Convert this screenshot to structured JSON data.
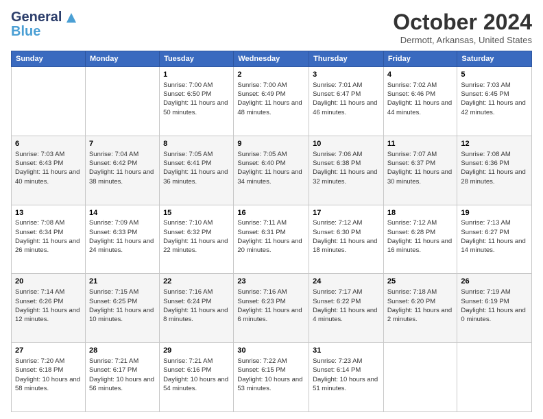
{
  "header": {
    "logo_line1": "General",
    "logo_line2": "Blue",
    "month_title": "October 2024",
    "location": "Dermott, Arkansas, United States"
  },
  "days_of_week": [
    "Sunday",
    "Monday",
    "Tuesday",
    "Wednesday",
    "Thursday",
    "Friday",
    "Saturday"
  ],
  "weeks": [
    [
      {
        "day": "",
        "info": ""
      },
      {
        "day": "",
        "info": ""
      },
      {
        "day": "1",
        "info": "Sunrise: 7:00 AM\nSunset: 6:50 PM\nDaylight: 11 hours and 50 minutes."
      },
      {
        "day": "2",
        "info": "Sunrise: 7:00 AM\nSunset: 6:49 PM\nDaylight: 11 hours and 48 minutes."
      },
      {
        "day": "3",
        "info": "Sunrise: 7:01 AM\nSunset: 6:47 PM\nDaylight: 11 hours and 46 minutes."
      },
      {
        "day": "4",
        "info": "Sunrise: 7:02 AM\nSunset: 6:46 PM\nDaylight: 11 hours and 44 minutes."
      },
      {
        "day": "5",
        "info": "Sunrise: 7:03 AM\nSunset: 6:45 PM\nDaylight: 11 hours and 42 minutes."
      }
    ],
    [
      {
        "day": "6",
        "info": "Sunrise: 7:03 AM\nSunset: 6:43 PM\nDaylight: 11 hours and 40 minutes."
      },
      {
        "day": "7",
        "info": "Sunrise: 7:04 AM\nSunset: 6:42 PM\nDaylight: 11 hours and 38 minutes."
      },
      {
        "day": "8",
        "info": "Sunrise: 7:05 AM\nSunset: 6:41 PM\nDaylight: 11 hours and 36 minutes."
      },
      {
        "day": "9",
        "info": "Sunrise: 7:05 AM\nSunset: 6:40 PM\nDaylight: 11 hours and 34 minutes."
      },
      {
        "day": "10",
        "info": "Sunrise: 7:06 AM\nSunset: 6:38 PM\nDaylight: 11 hours and 32 minutes."
      },
      {
        "day": "11",
        "info": "Sunrise: 7:07 AM\nSunset: 6:37 PM\nDaylight: 11 hours and 30 minutes."
      },
      {
        "day": "12",
        "info": "Sunrise: 7:08 AM\nSunset: 6:36 PM\nDaylight: 11 hours and 28 minutes."
      }
    ],
    [
      {
        "day": "13",
        "info": "Sunrise: 7:08 AM\nSunset: 6:34 PM\nDaylight: 11 hours and 26 minutes."
      },
      {
        "day": "14",
        "info": "Sunrise: 7:09 AM\nSunset: 6:33 PM\nDaylight: 11 hours and 24 minutes."
      },
      {
        "day": "15",
        "info": "Sunrise: 7:10 AM\nSunset: 6:32 PM\nDaylight: 11 hours and 22 minutes."
      },
      {
        "day": "16",
        "info": "Sunrise: 7:11 AM\nSunset: 6:31 PM\nDaylight: 11 hours and 20 minutes."
      },
      {
        "day": "17",
        "info": "Sunrise: 7:12 AM\nSunset: 6:30 PM\nDaylight: 11 hours and 18 minutes."
      },
      {
        "day": "18",
        "info": "Sunrise: 7:12 AM\nSunset: 6:28 PM\nDaylight: 11 hours and 16 minutes."
      },
      {
        "day": "19",
        "info": "Sunrise: 7:13 AM\nSunset: 6:27 PM\nDaylight: 11 hours and 14 minutes."
      }
    ],
    [
      {
        "day": "20",
        "info": "Sunrise: 7:14 AM\nSunset: 6:26 PM\nDaylight: 11 hours and 12 minutes."
      },
      {
        "day": "21",
        "info": "Sunrise: 7:15 AM\nSunset: 6:25 PM\nDaylight: 11 hours and 10 minutes."
      },
      {
        "day": "22",
        "info": "Sunrise: 7:16 AM\nSunset: 6:24 PM\nDaylight: 11 hours and 8 minutes."
      },
      {
        "day": "23",
        "info": "Sunrise: 7:16 AM\nSunset: 6:23 PM\nDaylight: 11 hours and 6 minutes."
      },
      {
        "day": "24",
        "info": "Sunrise: 7:17 AM\nSunset: 6:22 PM\nDaylight: 11 hours and 4 minutes."
      },
      {
        "day": "25",
        "info": "Sunrise: 7:18 AM\nSunset: 6:20 PM\nDaylight: 11 hours and 2 minutes."
      },
      {
        "day": "26",
        "info": "Sunrise: 7:19 AM\nSunset: 6:19 PM\nDaylight: 11 hours and 0 minutes."
      }
    ],
    [
      {
        "day": "27",
        "info": "Sunrise: 7:20 AM\nSunset: 6:18 PM\nDaylight: 10 hours and 58 minutes."
      },
      {
        "day": "28",
        "info": "Sunrise: 7:21 AM\nSunset: 6:17 PM\nDaylight: 10 hours and 56 minutes."
      },
      {
        "day": "29",
        "info": "Sunrise: 7:21 AM\nSunset: 6:16 PM\nDaylight: 10 hours and 54 minutes."
      },
      {
        "day": "30",
        "info": "Sunrise: 7:22 AM\nSunset: 6:15 PM\nDaylight: 10 hours and 53 minutes."
      },
      {
        "day": "31",
        "info": "Sunrise: 7:23 AM\nSunset: 6:14 PM\nDaylight: 10 hours and 51 minutes."
      },
      {
        "day": "",
        "info": ""
      },
      {
        "day": "",
        "info": ""
      }
    ]
  ]
}
